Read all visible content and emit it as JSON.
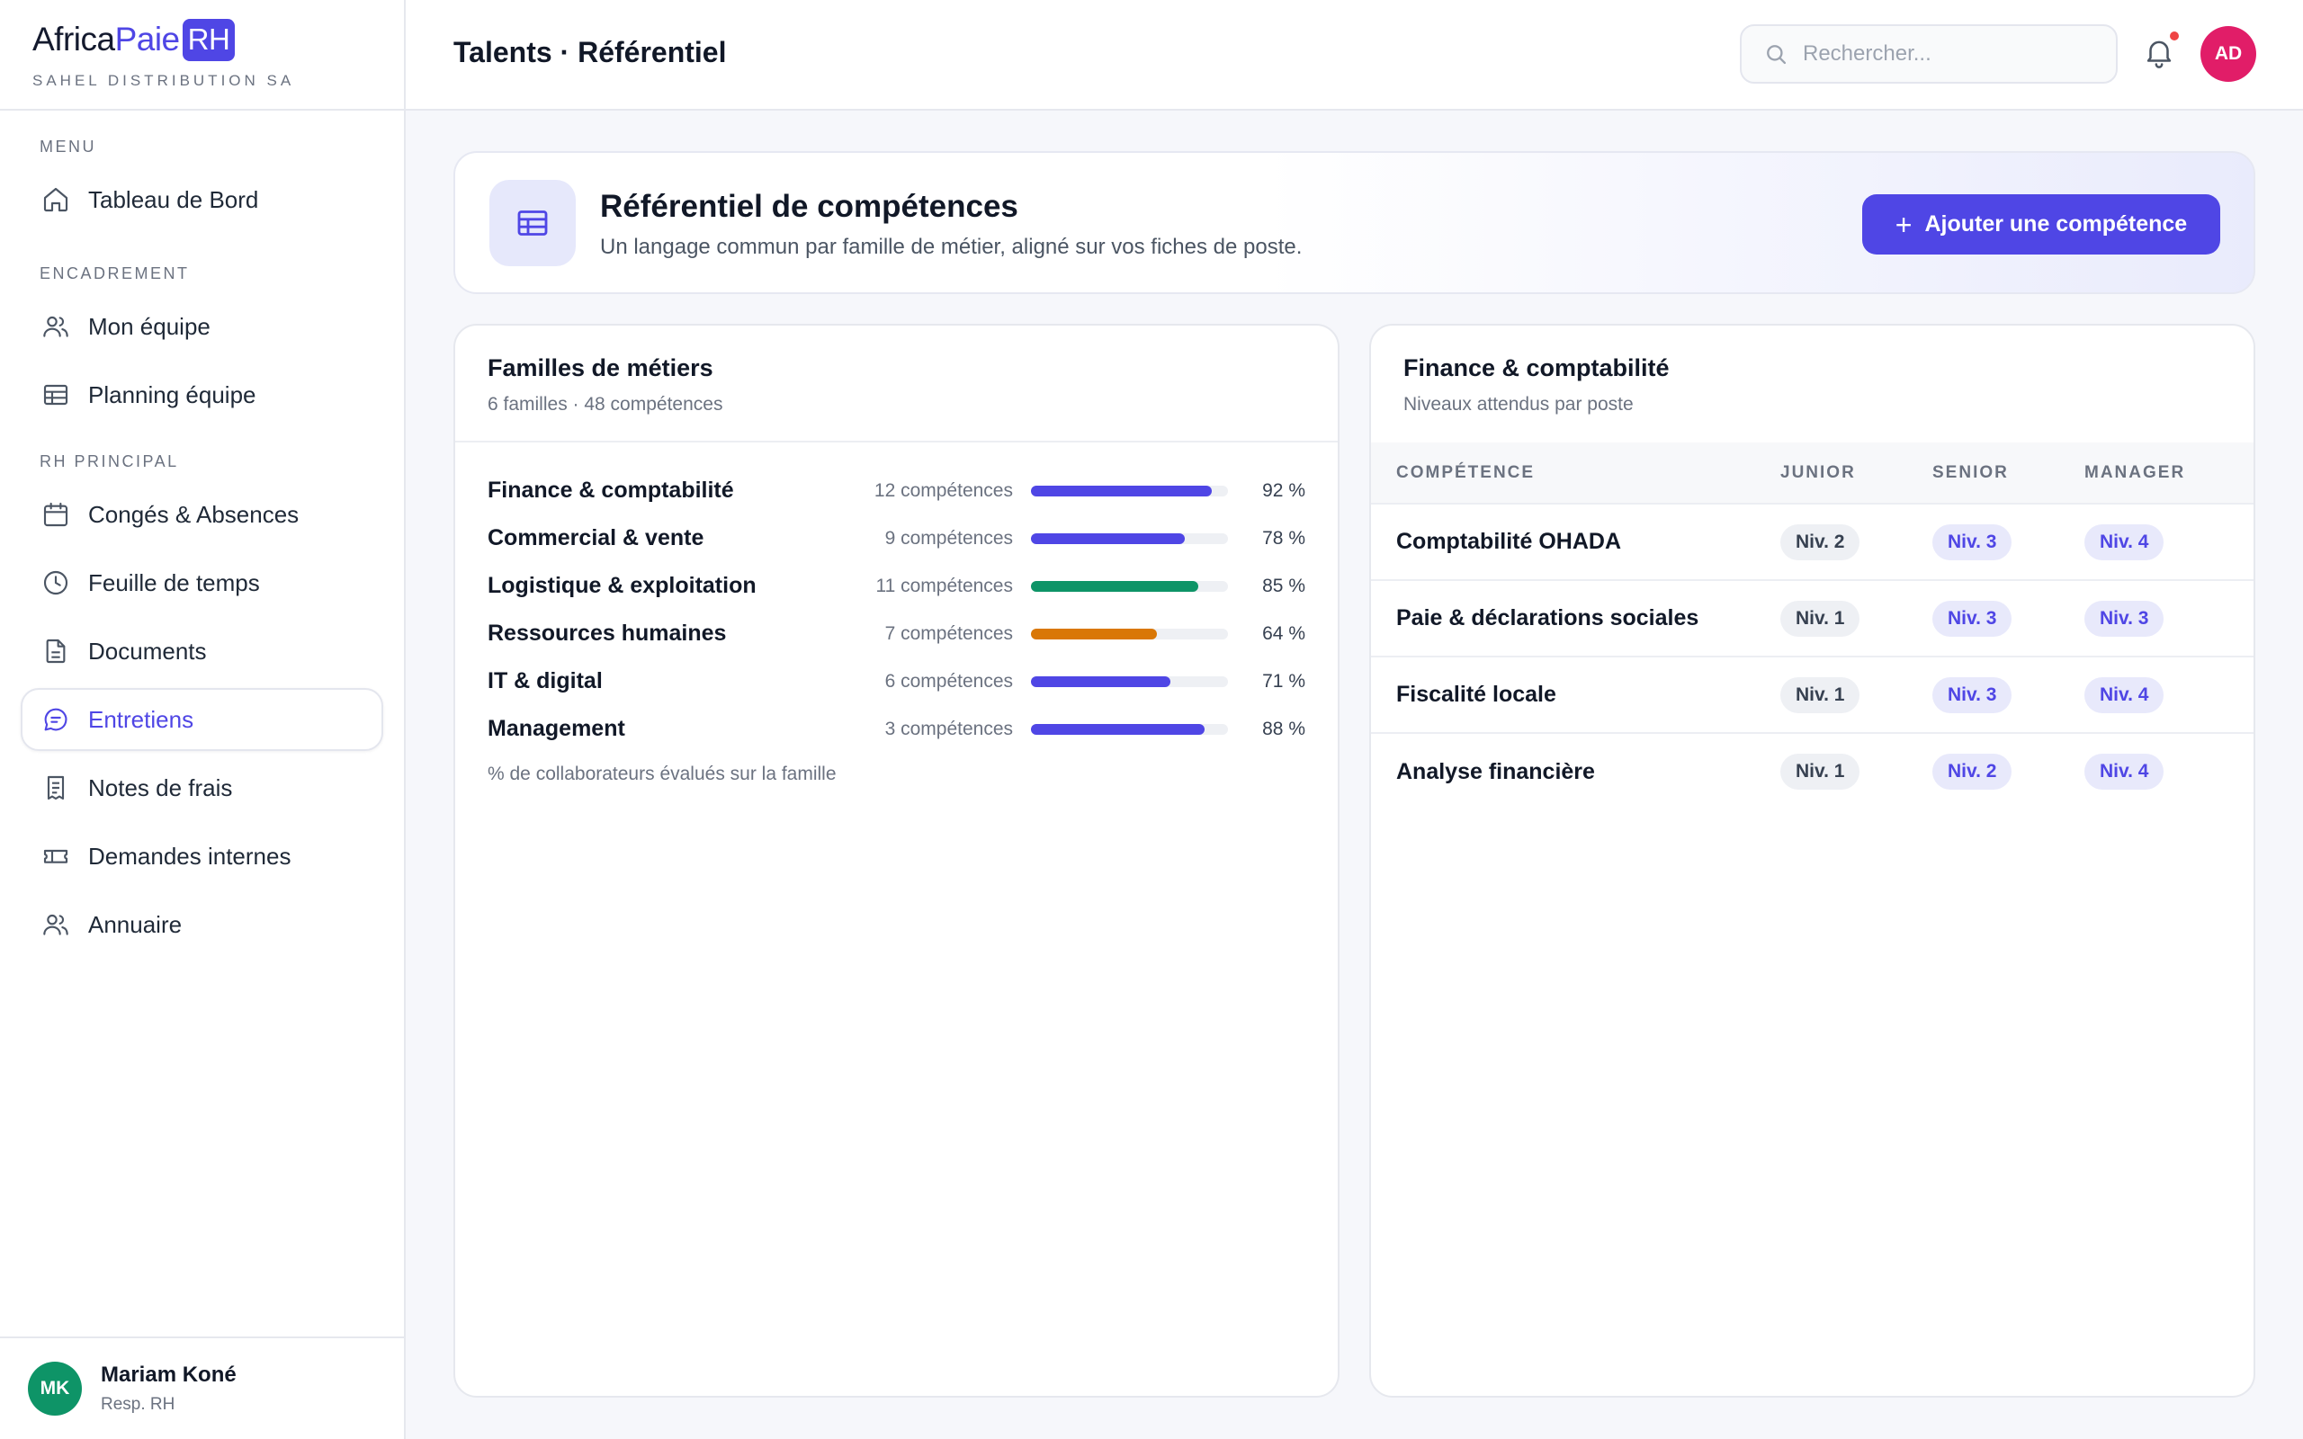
{
  "brand": {
    "logo_part1": "Africa",
    "logo_part2": "Paie",
    "logo_badge": "RH",
    "company": "SAHEL DISTRIBUTION SA"
  },
  "sidebar": {
    "sections": [
      {
        "label": "MENU",
        "items": [
          {
            "label": "Tableau de Bord",
            "icon": "home-icon"
          }
        ]
      },
      {
        "label": "ENCADREMENT",
        "items": [
          {
            "label": "Mon équipe",
            "icon": "users-icon"
          },
          {
            "label": "Planning équipe",
            "icon": "table-icon"
          }
        ]
      },
      {
        "label": "RH PRINCIPAL",
        "items": [
          {
            "label": "Congés & Absences",
            "icon": "calendar-icon"
          },
          {
            "label": "Feuille de temps",
            "icon": "clock-icon"
          },
          {
            "label": "Documents",
            "icon": "document-icon"
          },
          {
            "label": "Entretiens",
            "icon": "chat-icon",
            "active": true
          },
          {
            "label": "Notes de frais",
            "icon": "receipt-icon"
          },
          {
            "label": "Demandes internes",
            "icon": "ticket-icon"
          },
          {
            "label": "Annuaire",
            "icon": "users-icon"
          }
        ]
      }
    ]
  },
  "user": {
    "initials": "MK",
    "name": "Mariam Koné",
    "role": "Resp. RH"
  },
  "topbar": {
    "title": "Talents · Référentiel",
    "search_placeholder": "Rechercher...",
    "avatar_initials": "AD"
  },
  "hero": {
    "title": "Référentiel de compétences",
    "subtitle": "Un langage commun par famille de métier, aligné sur vos fiches de poste.",
    "button_label": "Ajouter une compétence"
  },
  "families": {
    "title": "Familles de métiers",
    "subtitle": "6 familles · 48 compétences",
    "note": "% de collaborateurs évalués sur la famille",
    "rows": [
      {
        "name": "Finance & comptabilité",
        "count": "12 compétences",
        "pct_label": "92 %",
        "value": 92,
        "color": "#4f46e5"
      },
      {
        "name": "Commercial & vente",
        "count": "9 compétences",
        "pct_label": "78 %",
        "value": 78,
        "color": "#4f46e5"
      },
      {
        "name": "Logistique & exploitation",
        "count": "11 compétences",
        "pct_label": "85 %",
        "value": 85,
        "color": "#0e9467"
      },
      {
        "name": "Ressources humaines",
        "count": "7 compétences",
        "pct_label": "64 %",
        "value": 64,
        "color": "#d97706"
      },
      {
        "name": "IT & digital",
        "count": "6 compétences",
        "pct_label": "71 %",
        "value": 71,
        "color": "#4f46e5"
      },
      {
        "name": "Management",
        "count": "3 compétences",
        "pct_label": "88 %",
        "value": 88,
        "color": "#4f46e5"
      }
    ]
  },
  "competences": {
    "title": "Finance & comptabilité",
    "subtitle": "Niveaux attendus par poste",
    "columns": [
      "COMPÉTENCE",
      "JUNIOR",
      "SENIOR",
      "MANAGER"
    ],
    "rows": [
      {
        "name": "Comptabilité OHADA",
        "junior": "Niv. 2",
        "senior": "Niv. 3",
        "manager": "Niv. 4"
      },
      {
        "name": "Paie & déclarations sociales",
        "junior": "Niv. 1",
        "senior": "Niv. 3",
        "manager": "Niv. 3"
      },
      {
        "name": "Fiscalité locale",
        "junior": "Niv. 1",
        "senior": "Niv. 3",
        "manager": "Niv. 4"
      },
      {
        "name": "Analyse financière",
        "junior": "Niv. 1",
        "senior": "Niv. 2",
        "manager": "Niv. 4"
      }
    ]
  }
}
